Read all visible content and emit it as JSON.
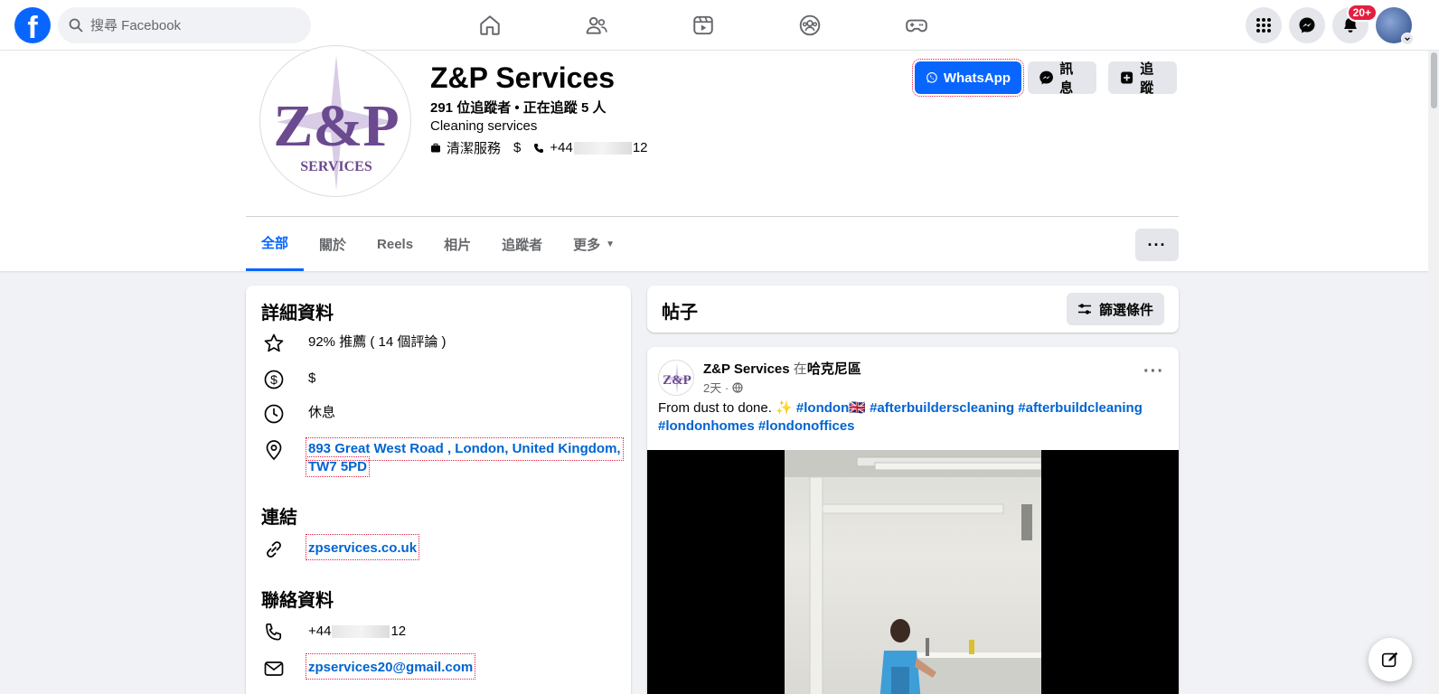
{
  "nav": {
    "search_placeholder": "搜尋 Facebook",
    "notification_badge": "20+"
  },
  "page": {
    "name": "Z&P Services",
    "followers": "291 位追蹤者 • 正在追蹤 5 人",
    "category": "Cleaning services",
    "category_tag": "清潔服務",
    "price": "$",
    "phone_prefix": "+44",
    "phone_suffix": "12",
    "logo_text_main": "Z&P",
    "logo_text_sub": "SERVICES"
  },
  "header_buttons": {
    "whatsapp": "WhatsApp",
    "message": "訊息",
    "follow": "追蹤"
  },
  "tabs": [
    {
      "label": "全部",
      "active": true
    },
    {
      "label": "關於"
    },
    {
      "label": "Reels"
    },
    {
      "label": "相片"
    },
    {
      "label": "追蹤者"
    },
    {
      "label": "更多"
    }
  ],
  "more_button": "···",
  "details": {
    "title": "詳細資料",
    "rating": "92% 推薦 ( 14 個評論 )",
    "price": "$",
    "hours": "休息",
    "address_line1": "893 Great West Road , London, United Kingdom,",
    "address_line2": "TW7 5PD",
    "links_title": "連結",
    "website": "zpservices.co.uk",
    "contact_title": "聯絡資料",
    "phone_prefix": "+44",
    "phone_suffix": "12",
    "email": "zpservices20@gmail.com"
  },
  "posts": {
    "title": "帖子",
    "filter": "篩選條件",
    "post": {
      "author": "Z&P Services",
      "in": "在",
      "location": "哈克尼區",
      "time": "2天 ·",
      "text": "From dust to done. ✨",
      "hashtags": [
        "#london🇬🇧",
        "#afterbuilderscleaning",
        "#afterbuildcleaning",
        "#londonhomes",
        "#londonoffices"
      ]
    }
  },
  "colors": {
    "brand_blue": "#0866ff",
    "link_blue": "#0064d1",
    "logo_purple": "#6b4a8f"
  }
}
